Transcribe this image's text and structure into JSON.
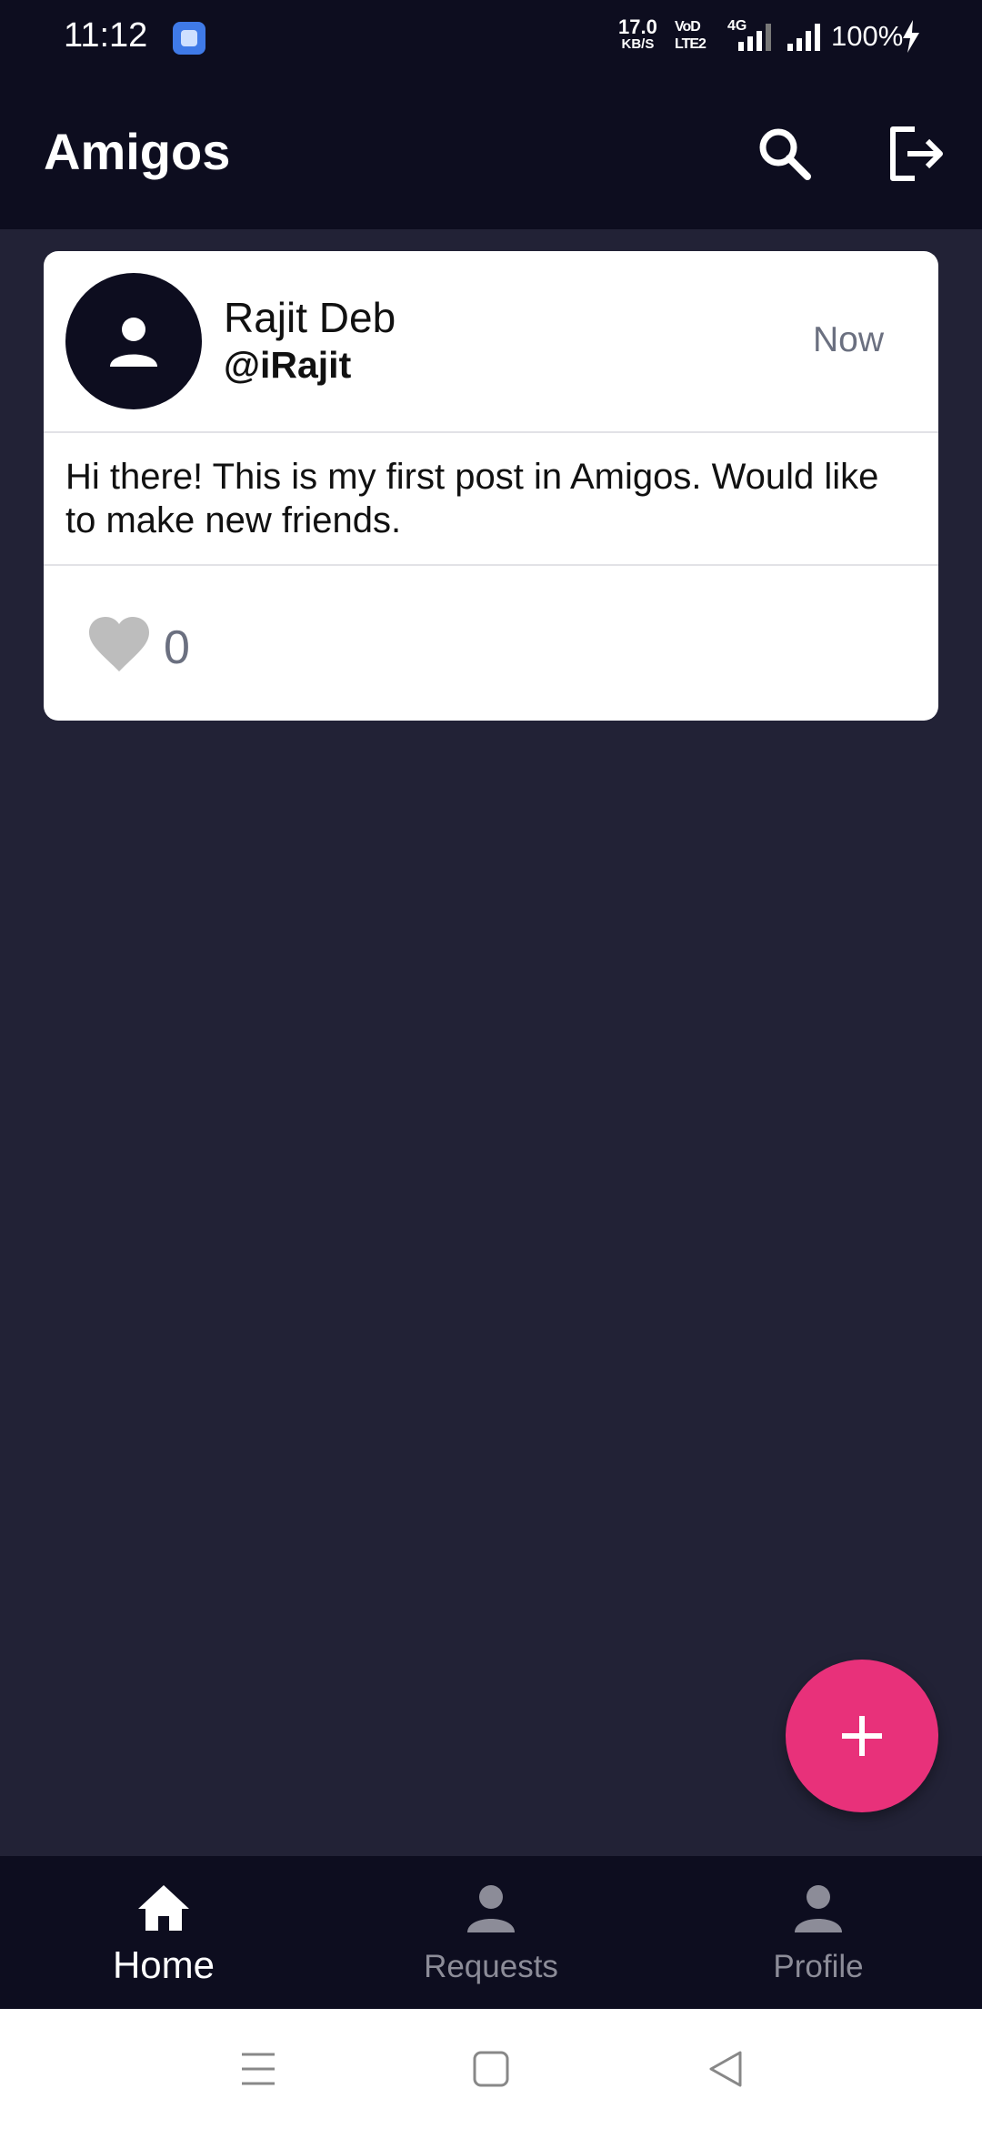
{
  "status_bar": {
    "time": "11:12",
    "net_speed_value": "17.0",
    "net_speed_unit": "KB/S",
    "volte_top": "VoD",
    "volte_bottom": "LTE2",
    "net_type": "4G",
    "battery": "100%"
  },
  "app_bar": {
    "title": "Amigos",
    "search_icon": "search-icon",
    "logout_icon": "logout-icon"
  },
  "post": {
    "author_name": "Rajit Deb",
    "author_handle": "@iRajit",
    "time": "Now",
    "body": "Hi there! This is my first post in Amigos. Would like to make new friends.",
    "like_count": "0"
  },
  "fab": {
    "icon": "plus-icon"
  },
  "bottom_nav": {
    "items": [
      {
        "label": "Home",
        "icon": "home-icon",
        "active": true
      },
      {
        "label": "Requests",
        "icon": "person-icon",
        "active": false
      },
      {
        "label": "Profile",
        "icon": "person-icon",
        "active": false
      }
    ]
  },
  "colors": {
    "background": "#222236",
    "bar": "#0d0d1f",
    "accent": "#e8317a",
    "card": "#ffffff",
    "muted": "#6b7080"
  }
}
